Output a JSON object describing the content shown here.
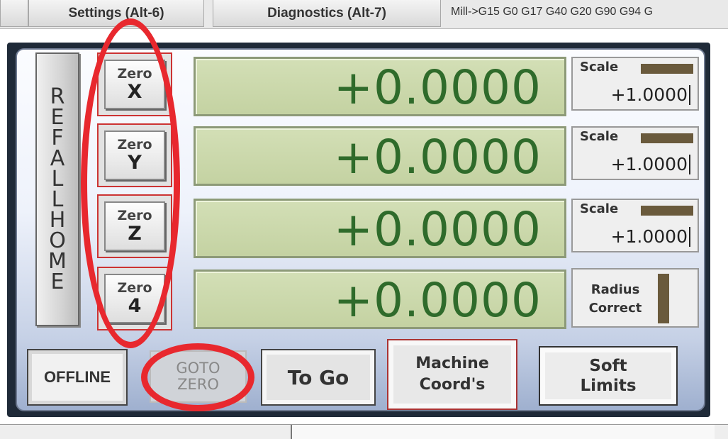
{
  "tabs": {
    "settings": "Settings (Alt-6)",
    "diagnostics": "Diagnostics (Alt-7)"
  },
  "modal_line": "Mill->G15  G0 G17 G40 G20 G90 G94 G",
  "ref_all_home": [
    "R",
    "E",
    "F",
    "A",
    "L",
    "L",
    "H",
    "O",
    "M",
    "E"
  ],
  "zero_buttons": [
    {
      "label": "Zero",
      "axis": "X"
    },
    {
      "label": "Zero",
      "axis": "Y"
    },
    {
      "label": "Zero",
      "axis": "Z"
    },
    {
      "label": "Zero",
      "axis": "4"
    }
  ],
  "dro_values": [
    "+0.0000",
    "+0.0000",
    "+0.0000",
    "+0.0000"
  ],
  "scales": [
    {
      "label": "Scale",
      "value": "+1.0000"
    },
    {
      "label": "Scale",
      "value": "+1.0000"
    },
    {
      "label": "Scale",
      "value": "+1.0000"
    }
  ],
  "radius_correct": {
    "line1": "Radius",
    "line2": "Correct"
  },
  "buttons": {
    "offline": "OFFLINE",
    "goto_zero": {
      "line1": "GOTO",
      "line2": "ZERO"
    },
    "to_go": "To Go",
    "machine_coords": {
      "line1": "Machine",
      "line2": "Coord's"
    },
    "soft_limits": {
      "line1": "Soft",
      "line2": "Limits"
    }
  },
  "colors": {
    "dro_text": "#2f6b2b",
    "dro_bg": "#c8d6a8",
    "annotation": "#e8282e",
    "indicator": "#6a5a3c"
  }
}
